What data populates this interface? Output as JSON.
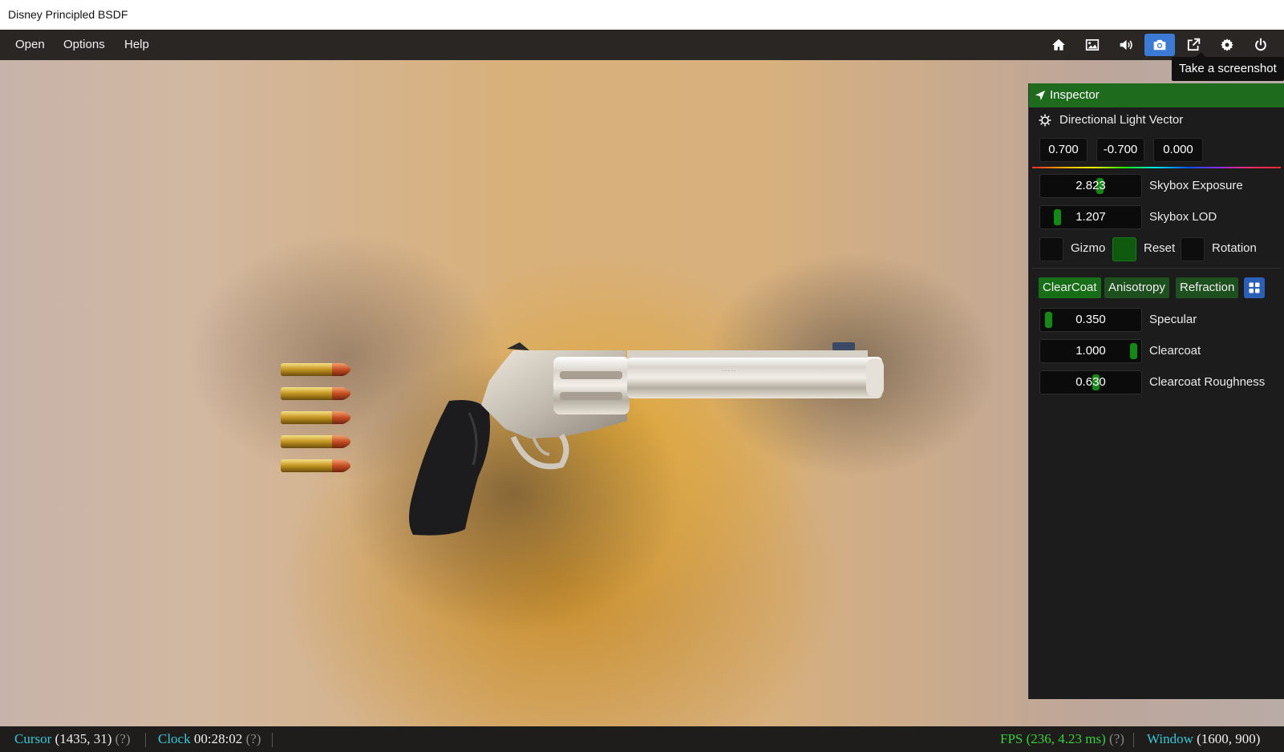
{
  "window": {
    "title": "Disney Principled BSDF"
  },
  "menu": {
    "open": "Open",
    "options": "Options",
    "help": "Help"
  },
  "toolbar": {
    "icons": [
      "home-icon",
      "image-icon",
      "sound-icon",
      "camera-icon",
      "external-link-icon",
      "gear-icon",
      "power-icon"
    ],
    "active": "camera-icon",
    "accent": "#3b7bd6"
  },
  "tooltip": "Take a screenshot",
  "inspector": {
    "title": "Inspector",
    "light_vector": {
      "label": "Directional Light Vector",
      "x": "0.700",
      "y": "-0.700",
      "z": "0.000"
    },
    "skybox_exposure": {
      "value": "2.823",
      "label": "Skybox Exposure",
      "fraction": 0.6
    },
    "skybox_lod": {
      "value": "1.207",
      "label": "Skybox LOD",
      "fraction": 0.12
    },
    "checkboxes": {
      "gizmo": {
        "label": "Gizmo",
        "checked": false
      },
      "reset": {
        "label": "Reset",
        "checked": true
      },
      "rotation": {
        "label": "Rotation",
        "checked": false
      }
    },
    "tabs": [
      "ClearCoat",
      "Anisotropy",
      "Refraction"
    ],
    "active_tab": "ClearCoat",
    "specular": {
      "value": "0.350",
      "label": "Specular",
      "fraction": 0.02
    },
    "clearcoat": {
      "value": "1.000",
      "label": "Clearcoat",
      "fraction": 0.98
    },
    "clearcoat_roughness": {
      "value": "0.630",
      "label": "Clearcoat Roughness",
      "fraction": 0.55
    },
    "header_color": "#1e6b1e",
    "slider_color": "#138a13"
  },
  "status": {
    "cursor_label": "Cursor",
    "cursor_value": "(1435, 31)",
    "clock_label": "Clock",
    "clock_value": "00:28:02",
    "help_mark": "(?)",
    "fps_label": "FPS",
    "fps_value": "(236, 4.23 ms)",
    "window_label": "Window",
    "window_value": "(1600, 900)"
  }
}
